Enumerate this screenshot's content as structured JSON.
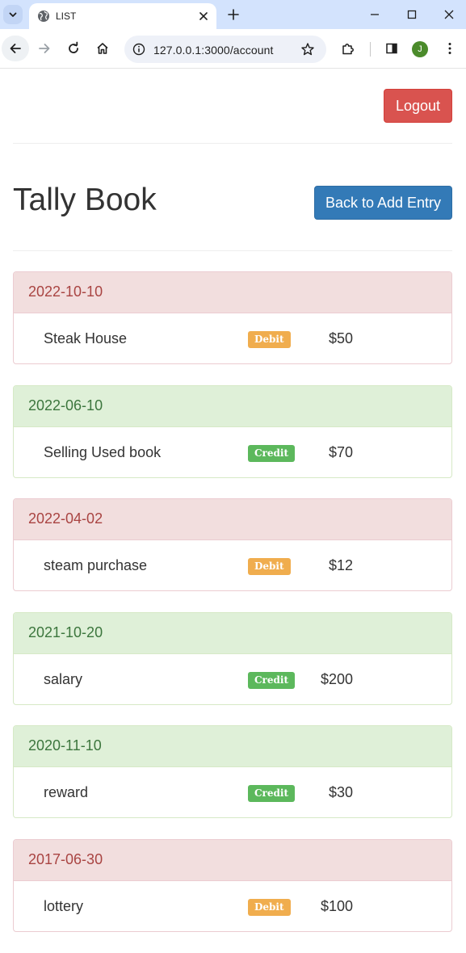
{
  "browser": {
    "tab_title": "LIST",
    "url": "127.0.0.1:3000/account",
    "avatar_initial": "J"
  },
  "header": {
    "logout_label": "Logout",
    "title": "Tally Book",
    "back_label": "Back to Add Entry"
  },
  "colors": {
    "debit_panel_bg": "#f2dede",
    "credit_panel_bg": "#dff0d8",
    "debit_badge": "#f0ad4e",
    "credit_badge": "#5cb85c",
    "logout_button": "#d9534f",
    "back_button": "#337ab7"
  },
  "entries": [
    {
      "date": "2022-10-10",
      "type": "debit",
      "description": "Steak House",
      "badge": "Debit",
      "amount": "$50"
    },
    {
      "date": "2022-06-10",
      "type": "credit",
      "description": "Selling Used book",
      "badge": "Credit",
      "amount": "$70"
    },
    {
      "date": "2022-04-02",
      "type": "debit",
      "description": "steam purchase",
      "badge": "Debit",
      "amount": "$12"
    },
    {
      "date": "2021-10-20",
      "type": "credit",
      "description": "salary",
      "badge": "Credit",
      "amount": "$200"
    },
    {
      "date": "2020-11-10",
      "type": "credit",
      "description": "reward",
      "badge": "Credit",
      "amount": "$30"
    },
    {
      "date": "2017-06-30",
      "type": "debit",
      "description": "lottery",
      "badge": "Debit",
      "amount": "$100"
    }
  ]
}
